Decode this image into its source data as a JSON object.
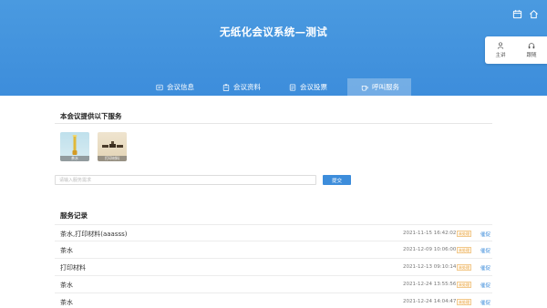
{
  "header": {
    "title": "无纸化会议系统—测试",
    "top_icons": [
      "calendar-icon",
      "home-icon"
    ],
    "roles": [
      {
        "label": "主讲",
        "icon": "user-speaker-icon"
      },
      {
        "label": "跟随",
        "icon": "headphones-icon"
      }
    ]
  },
  "tabs": [
    {
      "label": "会议信息",
      "icon": "meeting-info-icon",
      "active": false
    },
    {
      "label": "会议资料",
      "icon": "clipboard-icon",
      "active": false
    },
    {
      "label": "会议投票",
      "icon": "vote-icon",
      "active": false
    },
    {
      "label": "呼叫服务",
      "icon": "cup-icon",
      "active": true
    }
  ],
  "services": {
    "title": "本会议提供以下服务",
    "items": [
      {
        "caption": "茶水"
      },
      {
        "caption": "打印材料"
      }
    ],
    "remark_placeholder": "请输入服务需求",
    "submit_label": "提交"
  },
  "records": {
    "title": "服务记录",
    "rows": [
      {
        "name": "茶水,打印材料(aaasss)",
        "time": "2021-11-15 16:42:02",
        "status": "未处理",
        "action": "催促"
      },
      {
        "name": "茶水",
        "time": "2021-12-09 10:06:00",
        "status": "未处理",
        "action": "催促"
      },
      {
        "name": "打印材料",
        "time": "2021-12-13 09:10:14",
        "status": "未处理",
        "action": "催促"
      },
      {
        "name": "茶水",
        "time": "2021-12-24 13:55:56",
        "status": "未处理",
        "action": "催促"
      },
      {
        "name": "茶水",
        "time": "2021-12-24 14:04:47",
        "status": "未处理",
        "action": "催促"
      }
    ]
  },
  "colors": {
    "primary": "#3d8ddb",
    "badge": "#e8a33d"
  }
}
